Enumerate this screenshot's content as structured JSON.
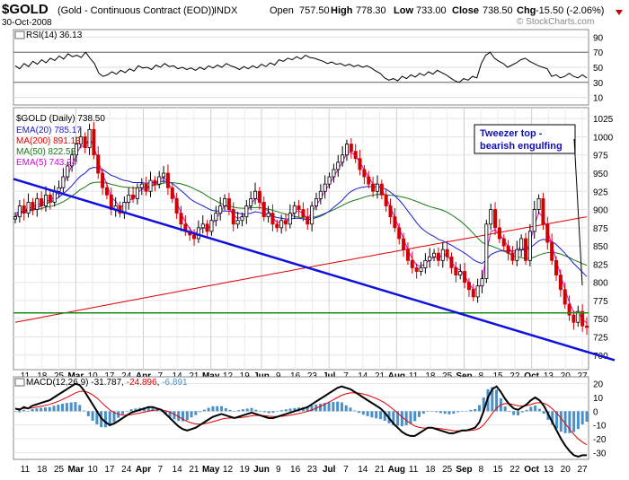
{
  "header": {
    "symbol": "$GOLD",
    "description": "(Gold - Continuous Contract (EOD))",
    "exchange": "INDX",
    "date": "30-Oct-2008",
    "watermark": "© StockCharts.com",
    "open_label": "Open",
    "open": "757.50",
    "high_label": "High",
    "high": "778.30",
    "low_label": "Low",
    "low": "733.00",
    "close_label": "Close",
    "close": "738.50",
    "chg_label": "Chg",
    "chg": "-15.50 (-2.06%)"
  },
  "annotation": {
    "line1": "Tweezer top -",
    "line2": "bearish engulfing"
  },
  "colors": {
    "price_up": "#000000",
    "price_down": "#d40000",
    "ema20": "#1a1ad8",
    "ma200": "#e00000",
    "ma50": "#1a7a1a",
    "ema5": "#e000e0",
    "trendline": "#1010e0",
    "support": "#1a8a1a",
    "macd": "#000000",
    "signal": "#e00000",
    "histogram": "#4a90c8",
    "annotation": "#1010c0"
  },
  "chart_data": [
    {
      "panel": "rsi",
      "type": "line",
      "legend": "RSI(14) 36.13",
      "y_ticks": [
        "90",
        "70",
        "50",
        "30",
        "10"
      ],
      "ylim": [
        0,
        100
      ],
      "reference_lines": [
        70,
        30
      ],
      "x": [
        0,
        5,
        10,
        15,
        20,
        25,
        30,
        35,
        40,
        45,
        50,
        55,
        60,
        65,
        70,
        75,
        80,
        85,
        90,
        95,
        100,
        105,
        110,
        115,
        120,
        125,
        130,
        135,
        140,
        145,
        150,
        155,
        160,
        165,
        170,
        175,
        180,
        185,
        190,
        195,
        200,
        205,
        210,
        215,
        220,
        225,
        230,
        235,
        240,
        245,
        250,
        255,
        260,
        265,
        270,
        275,
        280,
        285,
        290,
        295,
        300,
        305,
        310,
        315,
        320,
        325,
        330,
        335,
        340,
        345,
        350,
        355,
        360,
        365,
        370,
        375,
        380,
        385,
        390,
        395,
        400,
        405,
        410,
        415,
        420,
        425,
        430,
        435,
        440,
        445,
        450,
        455,
        460,
        465,
        470,
        475,
        480,
        485,
        490,
        495,
        500,
        505,
        510,
        515,
        520,
        525,
        530,
        535,
        540,
        545,
        550,
        555,
        560,
        565,
        570,
        575,
        580,
        585,
        590,
        595,
        600,
        605,
        610,
        615,
        620,
        625,
        630,
        635,
        640,
        645,
        650
      ],
      "values": [
        52,
        48,
        55,
        51,
        58,
        54,
        60,
        56,
        62,
        59,
        65,
        61,
        68,
        64,
        66,
        63,
        70,
        62,
        55,
        42,
        38,
        40,
        44,
        41,
        46,
        43,
        48,
        45,
        52,
        49,
        50,
        47,
        53,
        50,
        55,
        51,
        52,
        48,
        50,
        47,
        49,
        46,
        50,
        47,
        52,
        49,
        53,
        50,
        55,
        52,
        50,
        47,
        51,
        48,
        52,
        49,
        54,
        51,
        56,
        53,
        60,
        58,
        62,
        60,
        64,
        61,
        66,
        63,
        62,
        60,
        58,
        55,
        57,
        54,
        55,
        52,
        54,
        51,
        53,
        50,
        52,
        49,
        45,
        42,
        36,
        33,
        35,
        32,
        38,
        35,
        40,
        37,
        42,
        39,
        44,
        41,
        46,
        43,
        40,
        36,
        32,
        30,
        35,
        33,
        38,
        36,
        55,
        66,
        70,
        62,
        58,
        55,
        50,
        53,
        56,
        60,
        62,
        58,
        55,
        52,
        50,
        48,
        38,
        40,
        36,
        38,
        42,
        38,
        36,
        40,
        36
      ]
    },
    {
      "panel": "price",
      "type": "candlestick",
      "title": "$GOLD (Daily) 738.50",
      "legend": [
        {
          "name": "EMA(20) 785.17",
          "color": "#1a1ad8"
        },
        {
          "name": "MA(200) 891.13",
          "color": "#e00000"
        },
        {
          "name": "MA(50) 822.52",
          "color": "#1a7a1a"
        },
        {
          "name": "EMA(5) 743.24",
          "color": "#e000e0"
        }
      ],
      "y_ticks": [
        "1025",
        "1000",
        "975",
        "950",
        "925",
        "900",
        "875",
        "850",
        "825",
        "800",
        "775",
        "750",
        "725",
        "700"
      ],
      "ylim": [
        680,
        1040
      ],
      "x_axis_labels": [
        "11",
        "18",
        "25",
        "Mar",
        "10",
        "17",
        "24",
        "Apr",
        "7",
        "14",
        "21",
        "May",
        "12",
        "19",
        "Jun",
        "9",
        "16",
        "23",
        "Jul",
        "7",
        "14",
        "21",
        "Aug",
        "11",
        "18",
        "25",
        "Sep",
        "8",
        "15",
        "22",
        "Oct",
        "13",
        "20",
        "27"
      ],
      "annotations": [
        "Tweezer top - bearish engulfing"
      ],
      "horizontal_line": 758,
      "trendline_from": 942,
      "trendline_to": 693,
      "close": [
        890,
        905,
        895,
        910,
        900,
        915,
        905,
        920,
        910,
        925,
        930,
        945,
        960,
        975,
        990,
        1000,
        985,
        1010,
        975,
        950,
        930,
        920,
        900,
        905,
        895,
        910,
        920,
        915,
        930,
        935,
        925,
        940,
        935,
        945,
        950,
        930,
        915,
        895,
        880,
        870,
        865,
        860,
        875,
        880,
        870,
        885,
        895,
        905,
        915,
        900,
        880,
        885,
        890,
        905,
        915,
        925,
        910,
        890,
        895,
        880,
        875,
        885,
        880,
        895,
        905,
        900,
        890,
        880,
        905,
        915,
        925,
        935,
        945,
        955,
        965,
        975,
        990,
        980,
        970,
        955,
        945,
        935,
        925,
        935,
        920,
        905,
        890,
        875,
        860,
        845,
        830,
        820,
        815,
        820,
        830,
        835,
        840,
        830,
        845,
        835,
        820,
        810,
        815,
        800,
        790,
        780,
        795,
        805,
        880,
        900,
        875,
        860,
        850,
        840,
        830,
        845,
        860,
        830,
        870,
        900,
        915,
        880,
        855,
        830,
        810,
        790,
        770,
        755,
        745,
        760,
        740,
        738
      ],
      "ema20": [
        895,
        897,
        898,
        899,
        900,
        903,
        905,
        908,
        910,
        913,
        917,
        922,
        927,
        933,
        940,
        946,
        950,
        956,
        958,
        957,
        955,
        951,
        947,
        945,
        942,
        940,
        939,
        937,
        937,
        937,
        936,
        937,
        937,
        938,
        939,
        938,
        936,
        931,
        926,
        921,
        915,
        911,
        908,
        905,
        902,
        899,
        898,
        898,
        898,
        898,
        897,
        895,
        894,
        894,
        895,
        897,
        896,
        894,
        893,
        891,
        889,
        888,
        887,
        887,
        888,
        888,
        887,
        886,
        887,
        889,
        891,
        894,
        898,
        903,
        908,
        913,
        920,
        925,
        928,
        930,
        931,
        932,
        931,
        931,
        930,
        928,
        924,
        919,
        913,
        906,
        898,
        890,
        882,
        875,
        870,
        866,
        863,
        859,
        857,
        854,
        851,
        847,
        844,
        840,
        836,
        831,
        828,
        826,
        831,
        838,
        841,
        843,
        843,
        843,
        843,
        843,
        845,
        844,
        847,
        852,
        857,
        859,
        858,
        856,
        852,
        846,
        840,
        833,
        826,
        820,
        814,
        808
      ]
    },
    {
      "panel": "macd",
      "type": "line+histogram",
      "legend": "MACD(12,26,9) -31.787, -24.896, -6.891",
      "legend_values": [
        "-31.787",
        "-24.896",
        "-6.891"
      ],
      "y_ticks": [
        "20",
        "10",
        "0",
        "-10",
        "-20",
        "-30"
      ],
      "ylim": [
        -35,
        25
      ],
      "macd": [
        2,
        1,
        3,
        2,
        4,
        5,
        6,
        7,
        8,
        10,
        12,
        14,
        16,
        18,
        20,
        19,
        15,
        10,
        5,
        0,
        -5,
        -8,
        -10,
        -9,
        -7,
        -5,
        -3,
        -1,
        0,
        1,
        2,
        3,
        3,
        2,
        1,
        -2,
        -5,
        -8,
        -11,
        -13,
        -14,
        -13,
        -12,
        -10,
        -8,
        -6,
        -4,
        -3,
        -2,
        -3,
        -4,
        -5,
        -4,
        -3,
        -2,
        -1,
        -2,
        -3,
        -4,
        -5,
        -5,
        -4,
        -3,
        -2,
        -1,
        0,
        1,
        2,
        3,
        5,
        7,
        9,
        11,
        13,
        15,
        17,
        18,
        17,
        16,
        14,
        12,
        10,
        8,
        6,
        4,
        2,
        -1,
        -5,
        -9,
        -12,
        -15,
        -17,
        -18,
        -18,
        -16,
        -14,
        -12,
        -12,
        -13,
        -14,
        -15,
        -16,
        -16,
        -15,
        -14,
        -14,
        -13,
        -12,
        -8,
        0,
        10,
        16,
        18,
        14,
        9,
        5,
        2,
        1,
        3,
        5,
        8,
        10,
        8,
        4,
        -2,
        -8,
        -14,
        -20,
        -25,
        -29,
        -32,
        -33,
        -32,
        -32
      ]
    }
  ],
  "axis": {
    "rsi_ticks": [
      "90",
      "70",
      "50",
      "30",
      "10"
    ],
    "price_ticks": [
      "1025",
      "1000",
      "975",
      "950",
      "925",
      "900",
      "875",
      "850",
      "825",
      "800",
      "775",
      "750",
      "725",
      "700"
    ],
    "macd_ticks": [
      "20",
      "10",
      "0",
      "-10",
      "-20",
      "-30"
    ],
    "x_labels": [
      "11",
      "18",
      "25",
      "Mar",
      "10",
      "17",
      "24",
      "Apr",
      "7",
      "14",
      "21",
      "May",
      "12",
      "19",
      "Jun",
      "9",
      "16",
      "23",
      "Jul",
      "7",
      "14",
      "21",
      "Aug",
      "11",
      "18",
      "25",
      "Sep",
      "8",
      "15",
      "22",
      "Oct",
      "13",
      "20",
      "27"
    ]
  }
}
